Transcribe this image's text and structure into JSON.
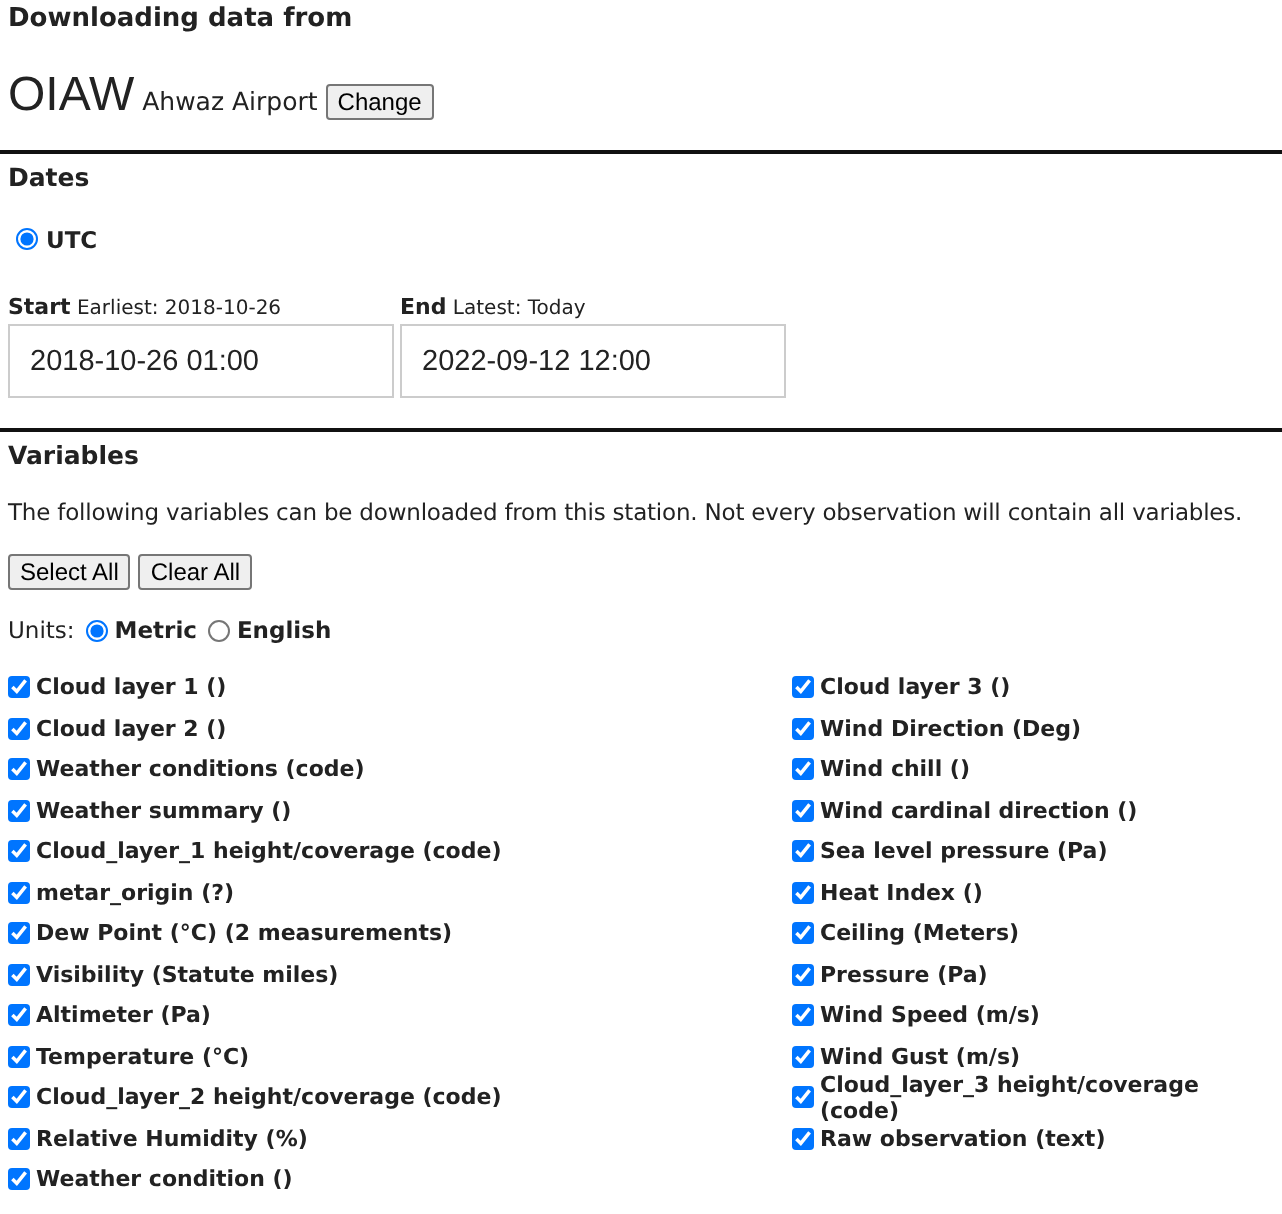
{
  "header": {
    "title": "Downloading data from",
    "station_id": "OIAW",
    "station_name": "Ahwaz Airport",
    "change_button": "Change"
  },
  "dates": {
    "heading": "Dates",
    "timezones": [
      {
        "label": "UTC",
        "selected": true
      }
    ],
    "fields": [
      {
        "label": "Start",
        "hint": "Earliest: 2018-10-26",
        "value": "2018-10-26 01:00"
      },
      {
        "label": "End",
        "hint": "Latest: Today",
        "value": "2022-09-12 12:00"
      }
    ]
  },
  "variables": {
    "heading": "Variables",
    "description": "The following variables can be downloaded from this station. Not every observation will contain all variables.",
    "buttons": [
      "Select All",
      "Clear All"
    ],
    "units_label": "Units:",
    "units": [
      {
        "label": "Metric",
        "selected": true
      },
      {
        "label": "English",
        "selected": false
      }
    ],
    "columns": [
      [
        {
          "label": "Cloud layer 1 ()",
          "checked": true
        },
        {
          "label": "Cloud layer 2 ()",
          "checked": true
        },
        {
          "label": "Weather conditions (code)",
          "checked": true
        },
        {
          "label": "Weather summary ()",
          "checked": true
        },
        {
          "label": "Cloud_layer_1 height/coverage (code)",
          "checked": true
        },
        {
          "label": "metar_origin (?)",
          "checked": true
        },
        {
          "label": "Dew Point (°C) (2 measurements)",
          "checked": true
        },
        {
          "label": "Visibility (Statute miles)",
          "checked": true
        },
        {
          "label": "Altimeter (Pa)",
          "checked": true
        },
        {
          "label": "Temperature (°C)",
          "checked": true
        },
        {
          "label": "Cloud_layer_2 height/coverage (code)",
          "checked": true
        },
        {
          "label": "Relative Humidity (%)",
          "checked": true
        },
        {
          "label": "Weather condition ()",
          "checked": true
        }
      ],
      [
        {
          "label": "Cloud layer 3 ()",
          "checked": true
        },
        {
          "label": "Wind Direction (Deg)",
          "checked": true
        },
        {
          "label": "Wind chill ()",
          "checked": true
        },
        {
          "label": "Wind cardinal direction ()",
          "checked": true
        },
        {
          "label": "Sea level pressure (Pa)",
          "checked": true
        },
        {
          "label": "Heat Index ()",
          "checked": true
        },
        {
          "label": "Ceiling (Meters)",
          "checked": true
        },
        {
          "label": "Pressure (Pa)",
          "checked": true
        },
        {
          "label": "Wind Speed (m/s)",
          "checked": true
        },
        {
          "label": "Wind Gust (m/s)",
          "checked": true
        },
        {
          "label": "Cloud_layer_3 height/coverage (code)",
          "checked": true
        },
        {
          "label": "Raw observation (text)",
          "checked": true
        }
      ]
    ]
  }
}
